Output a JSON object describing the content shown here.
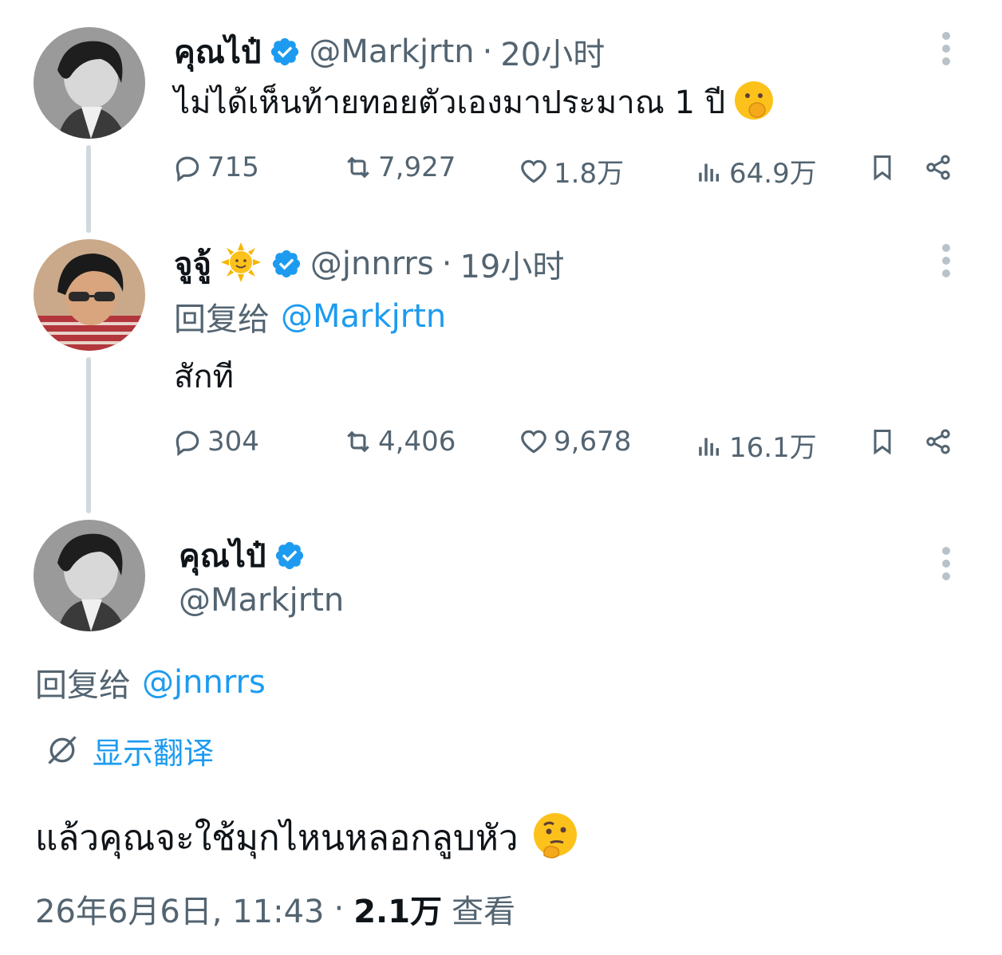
{
  "tweet1": {
    "display_name": "คุณไป๋",
    "handle": "@Markjrtn",
    "dot": "·",
    "time": "20小时",
    "text": "ไม่ได้เห็นท้ายทอยตัวเองมาประมาณ 1 ปี",
    "emoji": "shushing-face-emoji",
    "replies": "715",
    "retweets": "7,927",
    "likes": "1.8万",
    "views": "64.9万"
  },
  "tweet2": {
    "display_name": "จูจู้",
    "emoji_name": "sun-with-face-emoji",
    "handle": "@jnnrrs",
    "dot": "·",
    "time": "19小时",
    "reply_prefix": "回复给",
    "reply_to": "@Markjrtn",
    "text": "สักที",
    "replies": "304",
    "retweets": "4,406",
    "likes": "9,678",
    "views": "16.1万"
  },
  "main_tweet": {
    "display_name": "คุณไป๋",
    "handle": "@Markjrtn",
    "reply_prefix": "回复给",
    "reply_to": "@jnnrrs",
    "translate_label": "显示翻译",
    "text": "แล้วคุณจะใช้มุกไหนหลอกลูบหัว",
    "emoji": "thinking-face-emoji",
    "date": "26年6月6日, 11:43",
    "dot": "·",
    "view_count": "2.1万",
    "view_label": "查看"
  },
  "colors": {
    "accent": "#1d9bf0",
    "muted": "#536471",
    "text": "#0f1419",
    "thread_line": "#cfd9de"
  }
}
